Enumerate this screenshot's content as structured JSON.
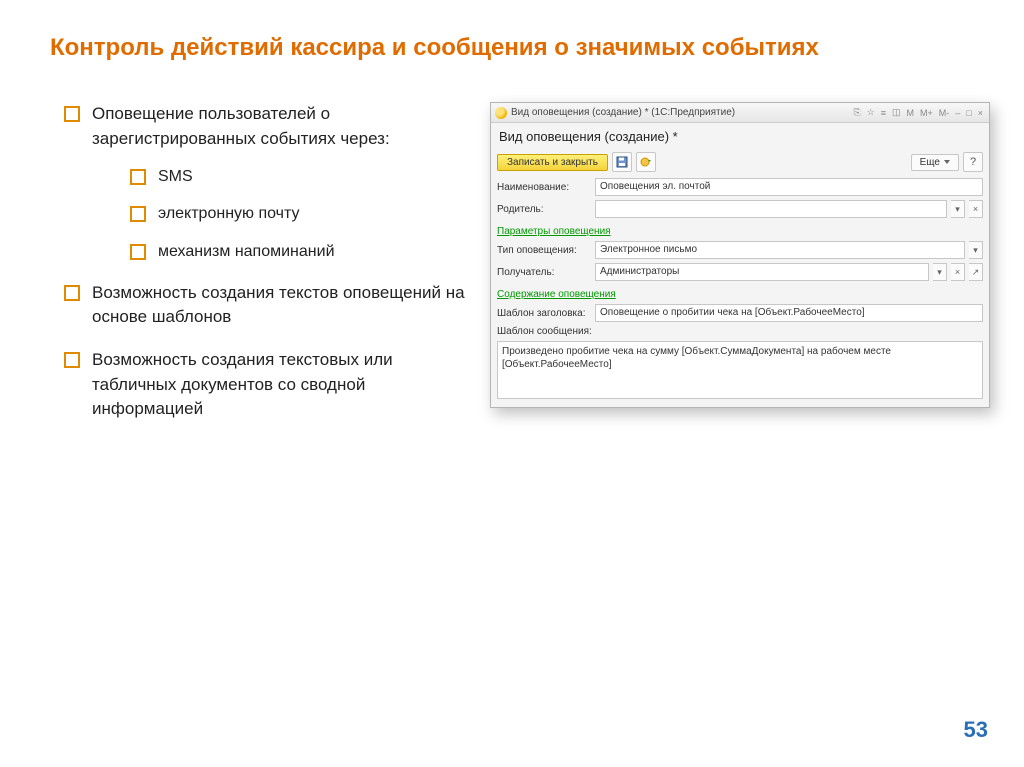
{
  "slide": {
    "title": "Контроль действий кассира и сообщения о значимых событиях",
    "page_number": "53"
  },
  "bullets": {
    "item1": "Оповещение пользователей о зарегистрированных событиях через:",
    "sub1": "SMS",
    "sub2": "электронную почту",
    "sub3": "механизм напоминаний",
    "item2": "Возможность создания текстов оповещений на основе шаблонов",
    "item3": "Возможность создания текстовых или табличных документов со сводной информацией"
  },
  "app": {
    "window_title": "Вид оповещения (создание) *  (1С:Предприятие)",
    "form_title": "Вид оповещения (создание) *",
    "toolbar": {
      "save_close": "Записать и закрыть",
      "more": "Еще",
      "help": "?"
    },
    "labels": {
      "name": "Наименование:",
      "parent": "Родитель:",
      "section_params": "Параметры оповещения",
      "type": "Тип оповещения:",
      "recipient": "Получатель:",
      "section_content": "Содержание оповещения",
      "template_title": "Шаблон заголовка:",
      "template_msg": "Шаблон сообщения:"
    },
    "fields": {
      "name_value": "Оповещения эл. почтой",
      "parent_value": "",
      "type_value": "Электронное письмо",
      "recipient_value": "Администраторы",
      "template_title_value": "Оповещение о пробитии чека на [Объект.РабочееМесто]",
      "template_msg_value": "Произведено пробитие чека на сумму [Объект.СуммаДокумента] на рабочем месте [Объект.РабочееМесто]"
    },
    "win_controls": [
      "⎘",
      "☆",
      "≡",
      "◫",
      "M",
      "M+",
      "M-",
      "–",
      "□",
      "×"
    ]
  }
}
